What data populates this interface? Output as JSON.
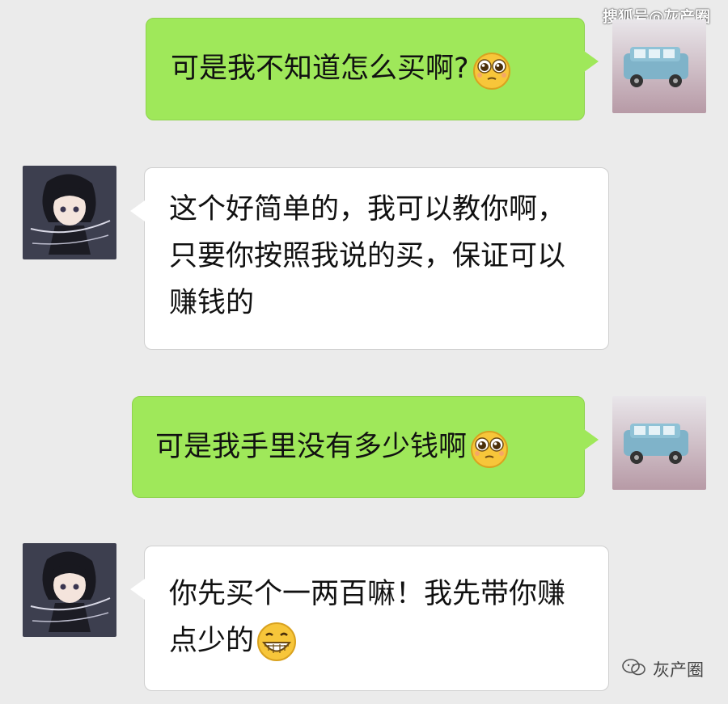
{
  "watermark": {
    "top": "搜狐号@灰产圈",
    "bottom": "灰产圈"
  },
  "messages": [
    {
      "side": "right",
      "text": "可是我不知道怎么买啊?",
      "emoji": "pleading-face-emoji",
      "avatar": "blue-car-avatar"
    },
    {
      "side": "left",
      "text": "这个好简单的，我可以教你啊，只要你按照我说的买，保证可以赚钱的",
      "avatar": "anime-girl-avatar"
    },
    {
      "side": "right",
      "text": "可是我手里没有多少钱啊",
      "emoji": "pleading-face-emoji",
      "avatar": "blue-car-avatar"
    },
    {
      "side": "left",
      "text": "你先买个一两百嘛！我先带你赚点少的",
      "emoji": "grinning-face-emoji",
      "avatar": "anime-girl-avatar"
    }
  ],
  "colors": {
    "background": "#ebebeb",
    "green_bubble": "#9fe85a",
    "white_bubble": "#ffffff"
  }
}
